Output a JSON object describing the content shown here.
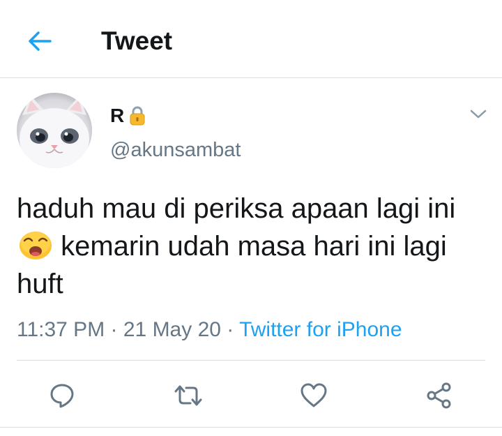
{
  "header": {
    "title": "Tweet",
    "back_icon": "arrow-left-icon"
  },
  "tweet": {
    "author": {
      "display_name": "R",
      "handle": "@akunsambat",
      "protected_icon": "lock-icon"
    },
    "text_before_emoji": "haduh mau di periksa apaan lagi ini",
    "text_after_emoji": " kemarin udah masa hari ini lagi huft",
    "emoji": "weary-face-emoji",
    "time": "11:37 PM",
    "sep1": " · ",
    "date": "21 May 20",
    "sep2": " · ",
    "source": "Twitter for iPhone"
  },
  "actions": [
    "reply-icon",
    "retweet-icon",
    "like-icon",
    "share-icon"
  ],
  "colors": {
    "accent": "#1da1f2",
    "secondary_text": "#657786",
    "icon_gray": "#657786",
    "text": "#14171a",
    "divider": "#d9dde1"
  }
}
